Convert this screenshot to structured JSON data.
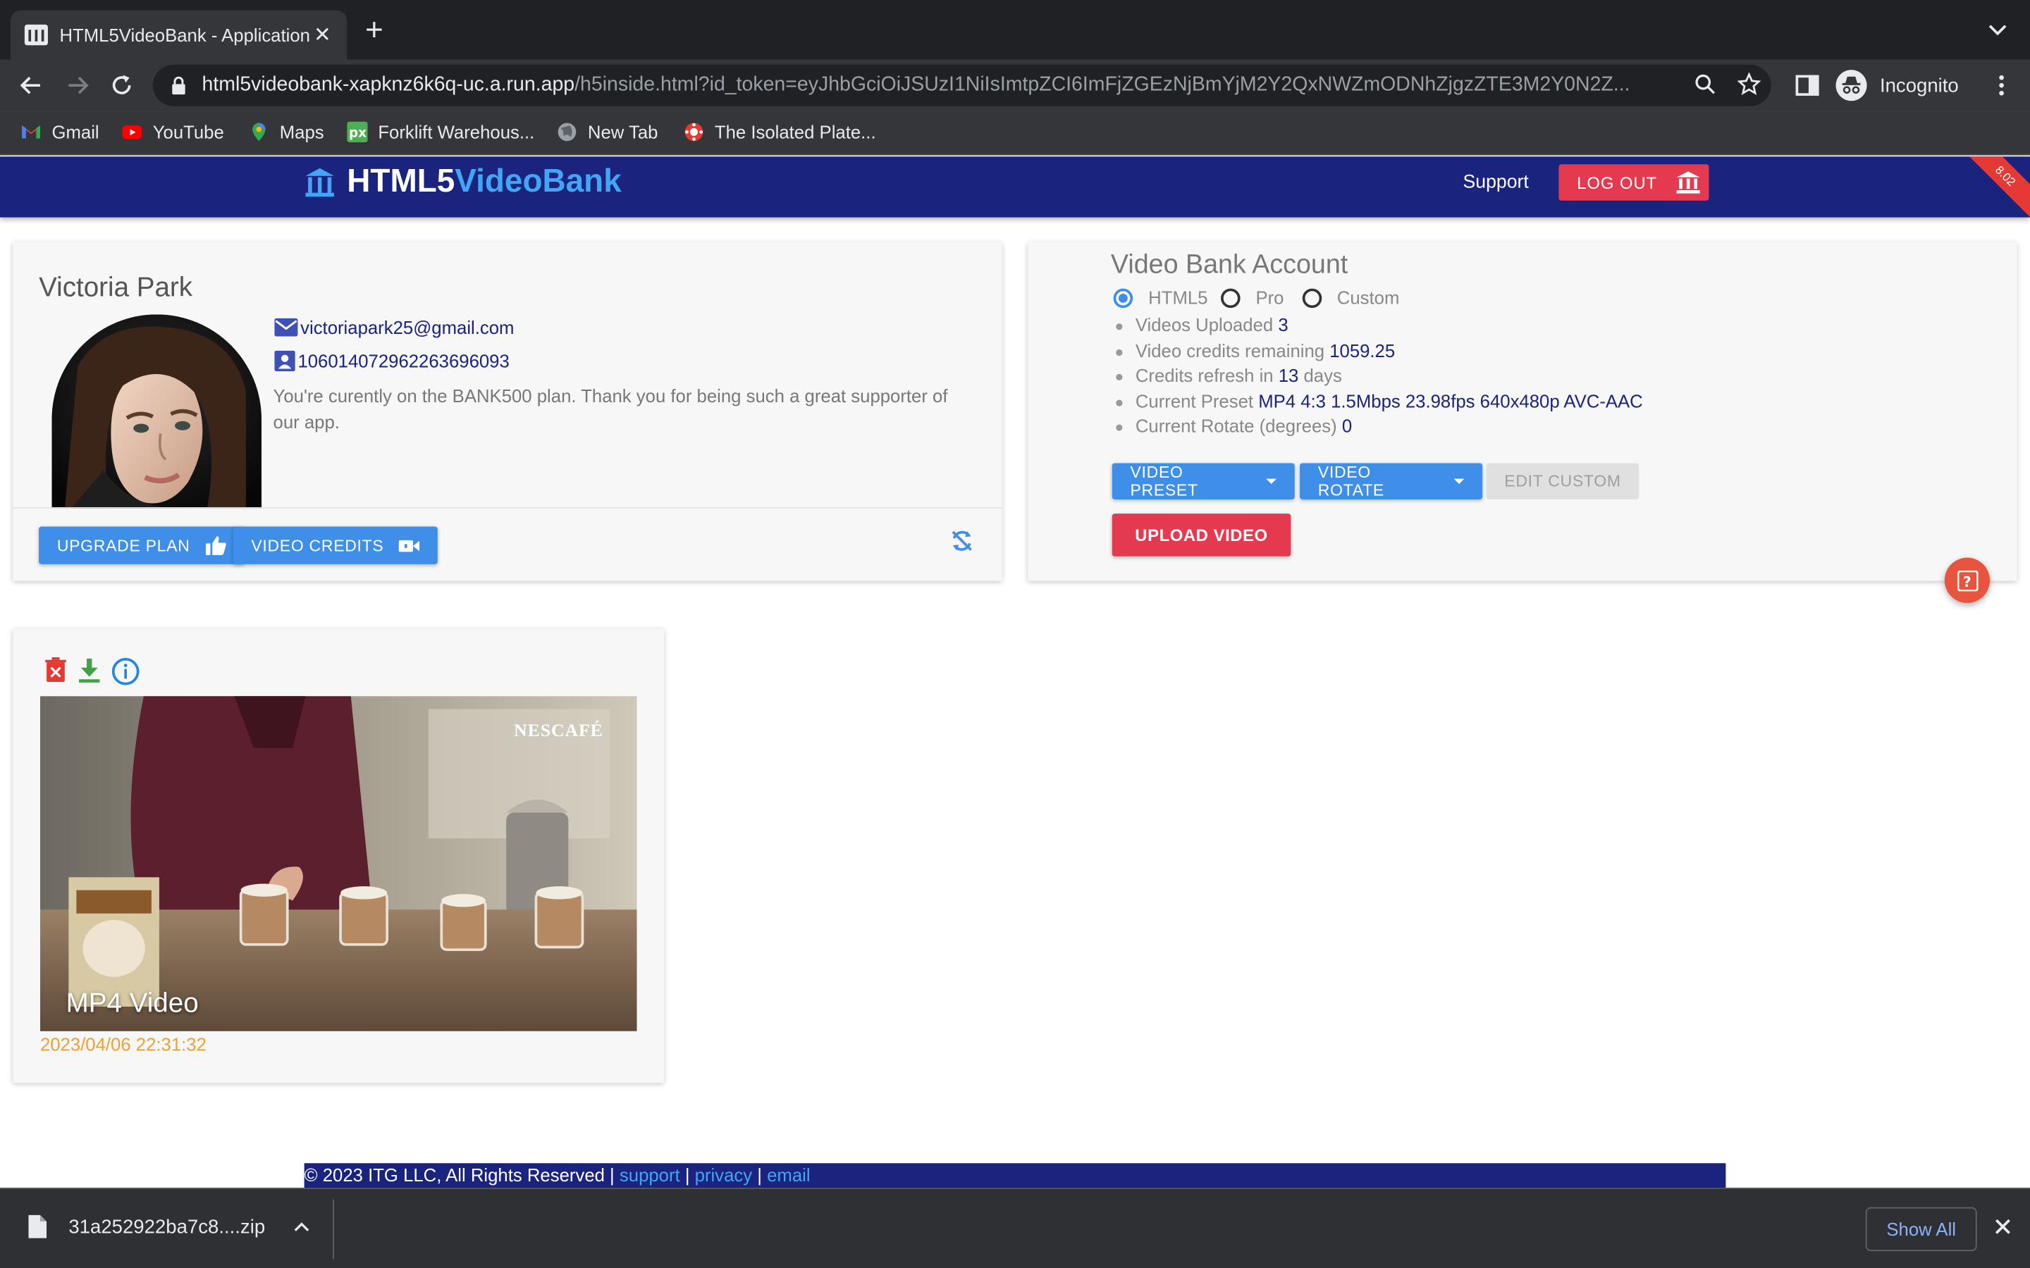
{
  "browser": {
    "tab_title": "HTML5VideoBank - Application",
    "url_host": "html5videobank-xapknz6k6q-uc.a.run.app",
    "url_path": "/h5inside.html?id_token=eyJhbGciOiJSUzI1NiIsImtpZCI6ImFjZGEzNjBmYjM2Y2QxNWZmODNhZjgzZTE3M2Y0N2Z...",
    "profile_label": "Incognito",
    "bookmarks": [
      {
        "label": "Gmail"
      },
      {
        "label": "YouTube"
      },
      {
        "label": "Maps"
      },
      {
        "label": "Forklift Warehous..."
      },
      {
        "label": "New Tab"
      },
      {
        "label": "The Isolated Plate..."
      }
    ]
  },
  "header": {
    "logo_part1": "HTML5",
    "logo_part2": "VideoBank",
    "support_label": "Support",
    "logout_label": "LOG OUT",
    "version": "8.02"
  },
  "profile": {
    "name": "Victoria Park",
    "email": "victoriapark25@gmail.com",
    "user_id": "106014072962263696093",
    "plan_message": "You're curently on the BANK500 plan. Thank you for being such a great supporter of our app.",
    "upgrade_label": "UPGRADE PLAN",
    "credits_label": "VIDEO CREDITS"
  },
  "account": {
    "title": "Video Bank Account",
    "options": [
      "HTML5",
      "Pro",
      "Custom"
    ],
    "selected_option": "HTML5",
    "stats": [
      {
        "label": "Videos Uploaded",
        "value": "3",
        "suffix": ""
      },
      {
        "label": "Video credits remaining",
        "value": "1059.25",
        "suffix": ""
      },
      {
        "label": "Credits refresh in",
        "value": "13",
        "suffix": "days"
      },
      {
        "label": "Current Preset",
        "value": "MP4 4:3 1.5Mbps 23.98fps 640x480p AVC-AAC",
        "suffix": ""
      },
      {
        "label": "Current Rotate (degrees)",
        "value": "0",
        "suffix": ""
      }
    ],
    "preset_label": "VIDEO PRESET",
    "rotate_label": "VIDEO ROTATE",
    "edit_custom_label": "EDIT CUSTOM",
    "upload_label": "UPLOAD VIDEO"
  },
  "video": {
    "caption": "MP4 Video",
    "brand": "NESCAFÉ",
    "date": "2023/04/06 22:31:32"
  },
  "footer": {
    "copyright": "© 2023 ITG LLC, All Rights Reserved |",
    "support": "support",
    "privacy": "privacy",
    "email": "email",
    "sep": "|"
  },
  "downloads": {
    "filename": "31a252922ba7c8....zip",
    "show_all": "Show All"
  },
  "colors": {
    "appbar": "#1a237e",
    "accent_blue": "#3f8fe8",
    "accent_red": "#e53950",
    "date_orange": "#f0a030"
  }
}
